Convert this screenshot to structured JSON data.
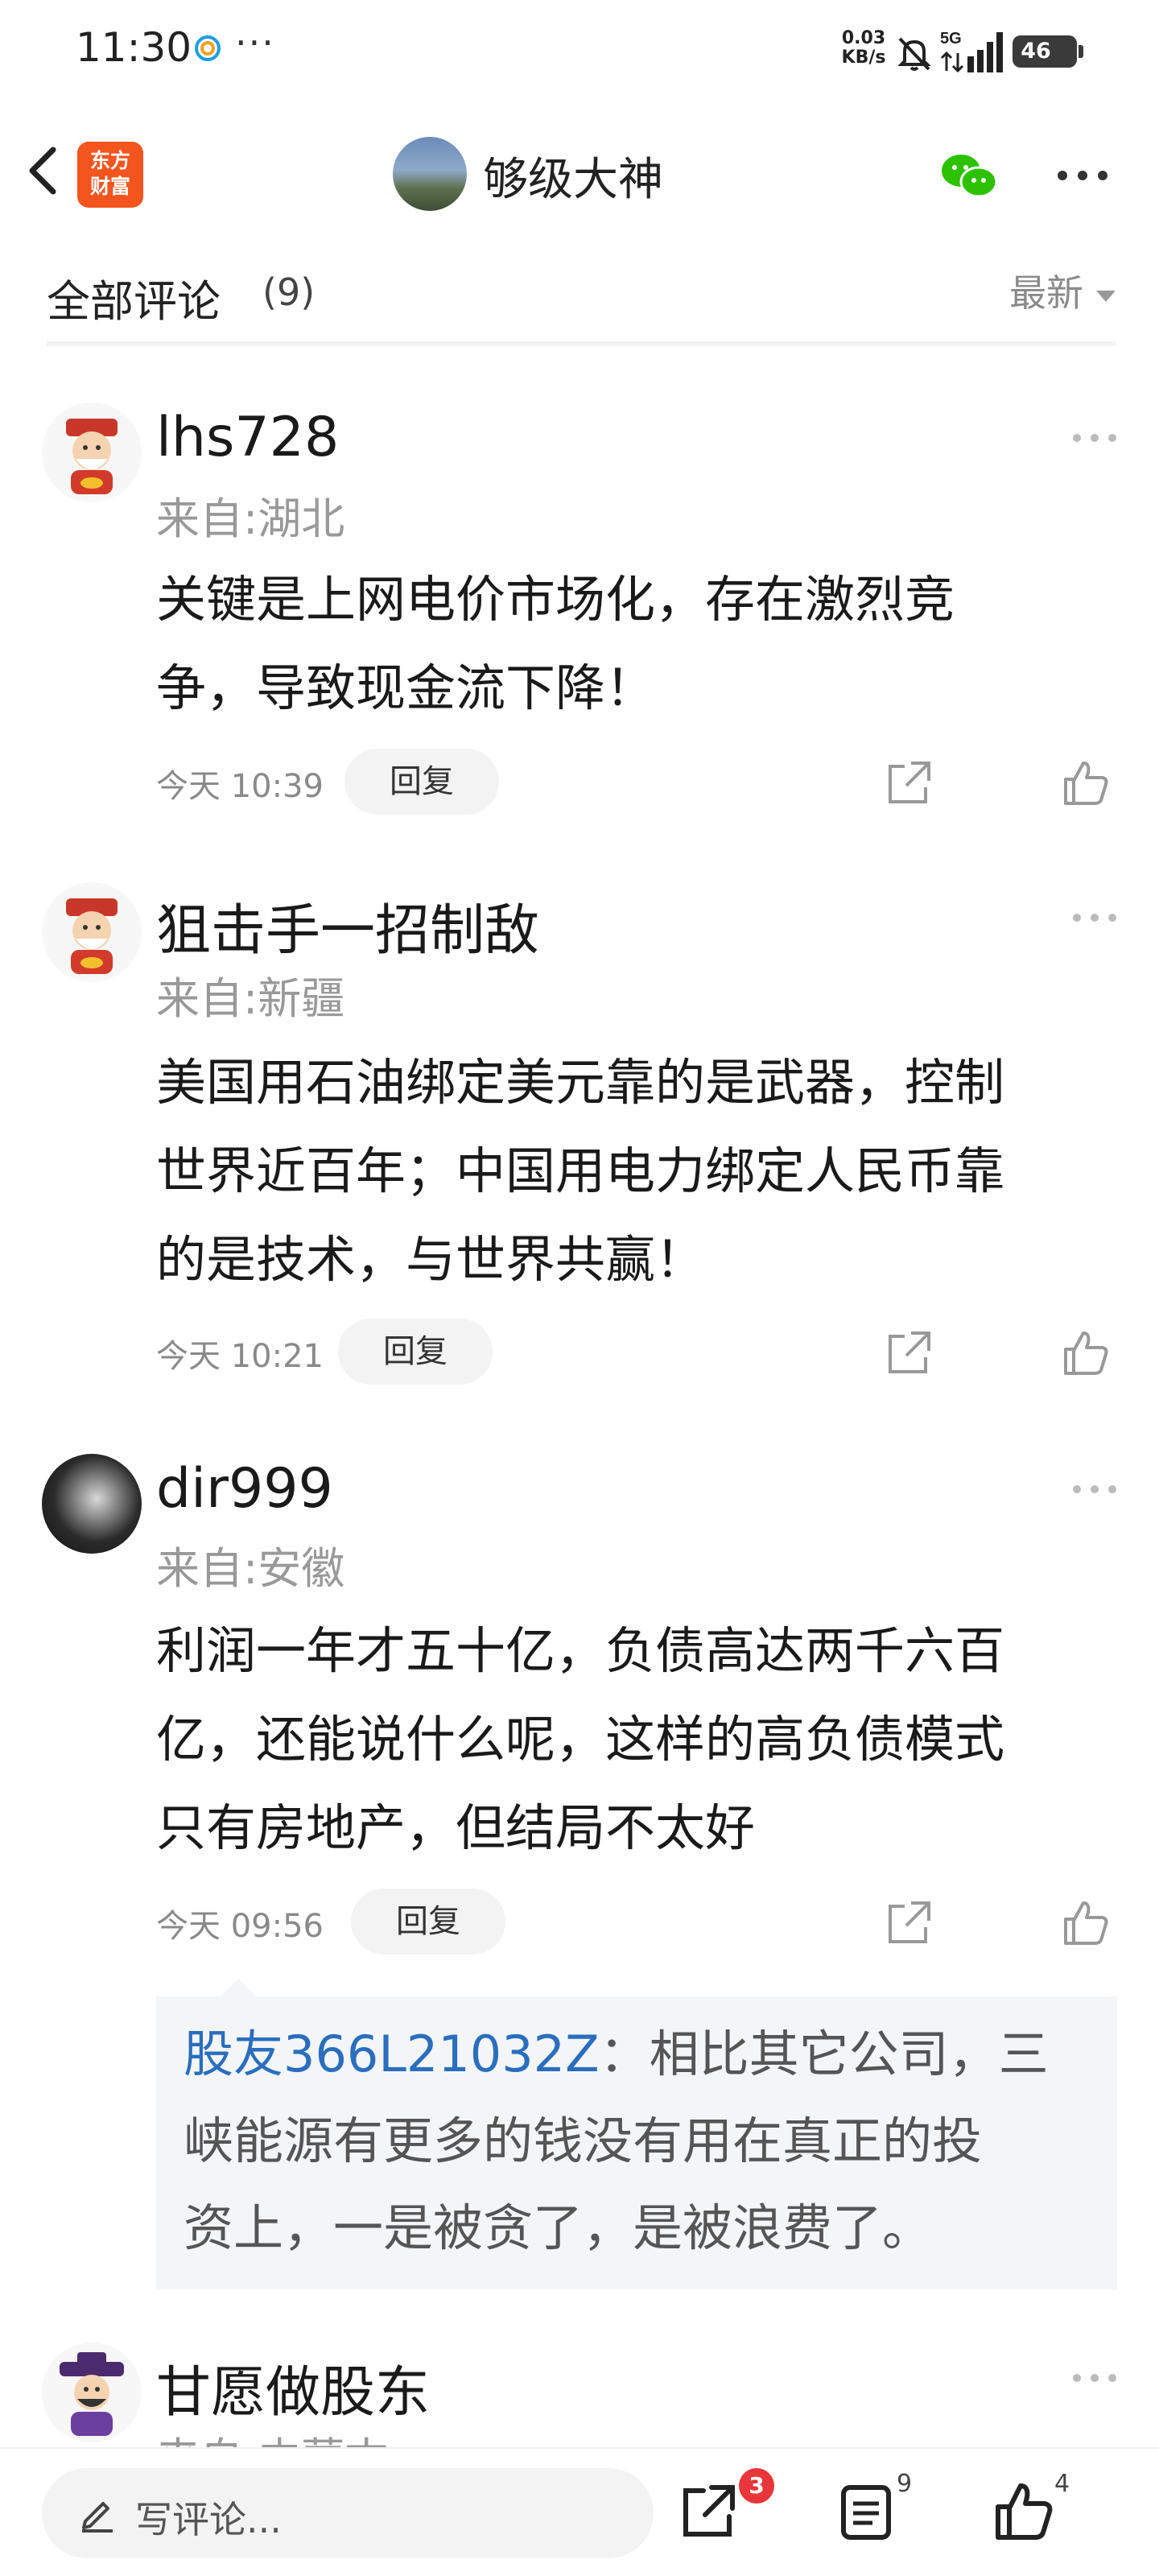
{
  "status_bar": {
    "time": "11:30",
    "dots": "···",
    "speed_value": "0.03",
    "speed_unit": "KB/s",
    "network": "5G",
    "battery": "46"
  },
  "nav": {
    "logo_line1": "东方",
    "logo_line2": "财富",
    "title": "够级大神"
  },
  "comments_header": {
    "title": "全部评论",
    "count": "(9)",
    "sort": "最新"
  },
  "comments": [
    {
      "user": "lhs728",
      "location": "来自:湖北",
      "lines": [
        "关键是上网电价市场化，存在激烈竞",
        "争，导致现金流下降！"
      ],
      "time": "今天 10:39",
      "reply_label": "回复"
    },
    {
      "user": "狙击手一招制敌",
      "location": "来自:新疆",
      "lines": [
        "美国用石油绑定美元靠的是武器，控制",
        "世界近百年；中国用电力绑定人民币靠",
        "的是技术，与世界共赢！"
      ],
      "time": "今天 10:21",
      "reply_label": "回复"
    },
    {
      "user": "dir999",
      "location": "来自:安徽",
      "lines": [
        "利润一年才五十亿，负债高达两千六百",
        "亿，还能说什么呢，这样的高负债模式",
        "只有房地产，但结局不太好"
      ],
      "time": "今天 09:56",
      "reply_label": "回复",
      "sub_reply": {
        "user": "股友366L21032Z",
        "line1": "：相比其它公司，三",
        "line2": "峡能源有更多的钱没有用在真正的投",
        "line3": "资上，一是被贪了，是被浪费了。"
      }
    },
    {
      "user": "甘愿做股东",
      "location": "来自:内蒙古"
    }
  ],
  "bottom_bar": {
    "placeholder": "写评论...",
    "share_badge": "3",
    "list_count": "9",
    "like_count": "4"
  },
  "colors": {
    "brand": "#f4541d",
    "link": "#2a6ebd",
    "badge": "#e8363a",
    "wechat": "#2dc100"
  }
}
